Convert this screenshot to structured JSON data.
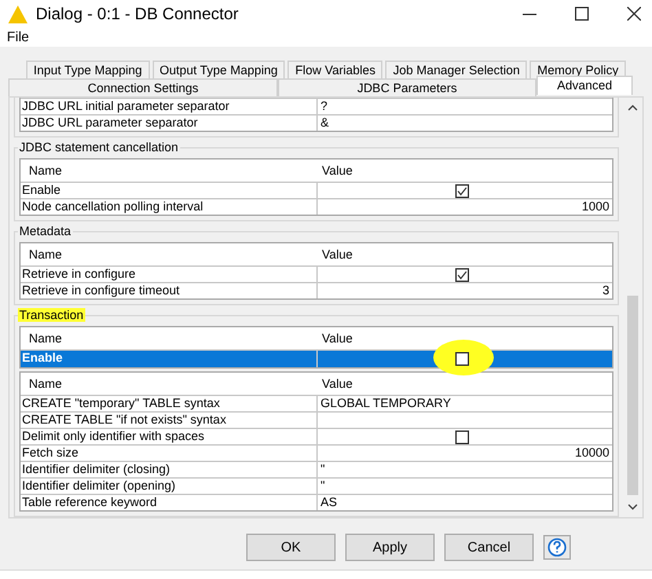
{
  "window": {
    "title": "Dialog - 0:1 - DB Connector"
  },
  "menu": [
    "File"
  ],
  "tab_rows": [
    [
      {
        "label": "Input Type Mapping",
        "selected": false
      },
      {
        "label": "Output Type Mapping",
        "selected": false
      },
      {
        "label": "Flow Variables",
        "selected": false
      },
      {
        "label": "Job Manager Selection",
        "selected": false
      },
      {
        "label": "Memory Policy",
        "selected": false
      }
    ],
    [
      {
        "label": "Connection Settings",
        "selected": false
      },
      {
        "label": "JDBC Parameters",
        "selected": false
      },
      {
        "label": "Advanced",
        "selected": true
      }
    ]
  ],
  "sections": [
    {
      "tables": [
        {
          "rows": [
            {
              "name": "JDBC URL initial parameter separator",
              "kind": "text",
              "value": "?",
              "selected": false
            },
            {
              "name": "JDBC URL parameter separator",
              "kind": "text",
              "value": "&",
              "selected": false
            }
          ]
        }
      ]
    },
    {
      "title": "JDBC statement cancellation",
      "highlighted": false,
      "tables": [
        {
          "header": [
            "Name",
            "Value"
          ],
          "rows": [
            {
              "name": "Enable",
              "kind": "checkbox",
              "checked": true,
              "selected": false
            },
            {
              "name": "Node cancellation polling interval",
              "kind": "number",
              "value": "1000",
              "selected": false
            }
          ]
        }
      ]
    },
    {
      "title": "Metadata",
      "highlighted": false,
      "tables": [
        {
          "header": [
            "Name",
            "Value"
          ],
          "rows": [
            {
              "name": "Retrieve in configure",
              "kind": "checkbox",
              "checked": true,
              "selected": false
            },
            {
              "name": "Retrieve in configure timeout",
              "kind": "number",
              "value": "3",
              "selected": false
            }
          ]
        }
      ]
    },
    {
      "title": "Transaction",
      "highlighted": true,
      "tables": [
        {
          "header": [
            "Name",
            "Value"
          ],
          "rows": [
            {
              "name": "Enable",
              "kind": "checkbox",
              "checked": false,
              "selected": true,
              "annotated": true
            }
          ]
        },
        {
          "header": [
            "Name",
            "Value"
          ],
          "rows": [
            {
              "name": "CREATE \"temporary\" TABLE syntax",
              "kind": "text",
              "value": "GLOBAL TEMPORARY",
              "selected": false
            },
            {
              "name": "CREATE TABLE \"if not exists\" syntax",
              "kind": "text",
              "value": "",
              "selected": false
            },
            {
              "name": "Delimit only identifier with spaces",
              "kind": "checkbox",
              "checked": false,
              "selected": false
            },
            {
              "name": "Fetch size",
              "kind": "number",
              "value": "10000",
              "selected": false
            },
            {
              "name": "Identifier delimiter (closing)",
              "kind": "text",
              "value": "\"",
              "selected": false
            },
            {
              "name": "Identifier delimiter (opening)",
              "kind": "text",
              "value": "\"",
              "selected": false
            },
            {
              "name": "Table reference keyword",
              "kind": "text",
              "value": "AS",
              "selected": false
            }
          ]
        }
      ]
    }
  ],
  "buttons": [
    "OK",
    "Apply",
    "Cancel"
  ]
}
